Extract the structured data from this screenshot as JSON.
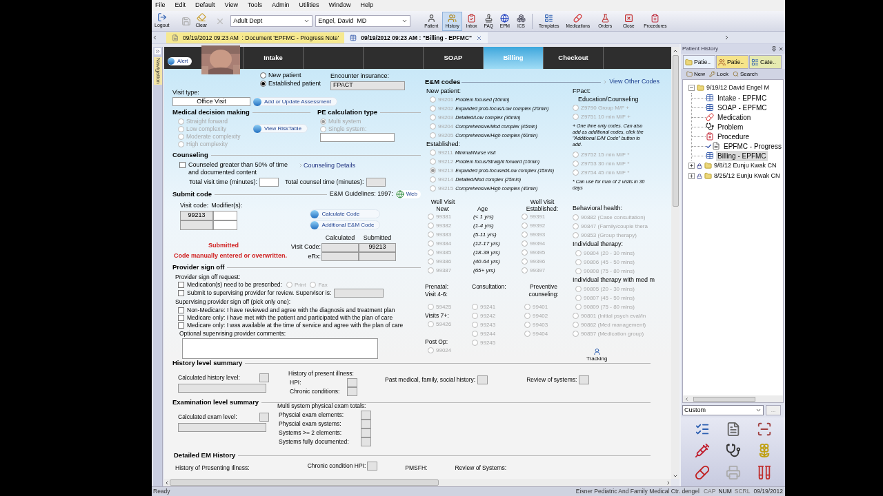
{
  "menu": [
    "File",
    "Edit",
    "Default",
    "View",
    "Tools",
    "Admin",
    "Utilities",
    "Window",
    "Help"
  ],
  "toolbar": {
    "logout": "Logout",
    "clear": "Clear",
    "department": "Adult Dept",
    "provider": "Engel, David  MD",
    "buttons": [
      {
        "label": "Patient",
        "selected": false
      },
      {
        "label": "History",
        "selected": true
      },
      {
        "label": "Inbox",
        "selected": false
      },
      {
        "label": "PAQ",
        "selected": false
      },
      {
        "label": "EPM",
        "selected": false
      },
      {
        "label": "ICS",
        "selected": false
      },
      {
        "label": "Templates",
        "selected": false
      },
      {
        "label": "Medications",
        "selected": false
      },
      {
        "label": "Orders",
        "selected": false
      },
      {
        "label": "Close",
        "selected": false
      },
      {
        "label": "Procedures",
        "selected": false
      }
    ]
  },
  "doc_tabs": [
    {
      "label": "09/19/2012 09:23 AM  : Document 'EPFMC - Progress Note'",
      "selected": false
    },
    {
      "label": "09/19/2012 09:23 AM : \"Billing - EPFMC\"",
      "selected": true
    }
  ],
  "navigation": "Navigation",
  "alert": "Alert",
  "form_tabs": [
    {
      "kind": "tab",
      "label": "Intake",
      "selected": false
    },
    {
      "kind": "blank"
    },
    {
      "kind": "blank"
    },
    {
      "kind": "tab",
      "label": "SOAP",
      "selected": false
    },
    {
      "kind": "tab",
      "label": "Billing",
      "selected": true
    },
    {
      "kind": "tab",
      "label": "Checkout",
      "selected": false
    },
    {
      "kind": "blank"
    }
  ],
  "patient_type": [
    {
      "label": "New patient",
      "selected": false
    },
    {
      "label": "Established patient",
      "selected": true
    }
  ],
  "encounter_insurance": {
    "label": "Encounter insurance:",
    "value": "FPACT"
  },
  "visit_type": {
    "label": "Visit type:",
    "value": "Office Visit"
  },
  "assessment_button": "Add or Update Assessment",
  "mdm": {
    "title": "Medical decision making",
    "disabled": true,
    "button": "View RiskTable",
    "options": [
      {
        "label": "Straight forward",
        "selected": false
      },
      {
        "label": "Low complexity",
        "selected": false
      },
      {
        "label": "Moderate complexity",
        "selected": false
      },
      {
        "label": "High complexity",
        "selected": false
      }
    ]
  },
  "pe": {
    "title": "PE calculation type",
    "disabled": true,
    "options": [
      {
        "label": "Multi system",
        "selected": true
      },
      {
        "label": "Single system:",
        "selected": false
      }
    ]
  },
  "counseling": {
    "title": "Counseling",
    "checkbox": {
      "label": "Counseled greater than 50% of time and documented content",
      "checked": false
    },
    "details_link": "Counseling Details",
    "visit_time_label": "Total visit time (minutes):",
    "counsel_time_label": "Total counsel time (minutes):"
  },
  "submit": {
    "title": "Submit code",
    "guidelines": "E&M Guidelines: 1997:",
    "web_button": "Web",
    "visit_code_label": "Visit code:",
    "modifier_label": "Modifier(s):",
    "visit_code": "99213",
    "buttons": [
      "Calculate Code",
      "Additional E&M Code"
    ],
    "status": "Submitted",
    "warning": "Code manually entered or overwritten.",
    "calculated_header": "Calculated",
    "submitted_header": "Submitted",
    "rows": [
      {
        "label": "Visit Code:",
        "submitted": "99213"
      },
      {
        "label": "eRx:"
      }
    ]
  },
  "signoff": {
    "title": "Provider sign off",
    "request_label": "Provider sign off request:",
    "medication": {
      "label": "Medication(s) need to be prescribed:",
      "checked": false
    },
    "delivery": [
      {
        "label": "Print",
        "selected": false
      },
      {
        "label": "Fax",
        "selected": false
      }
    ],
    "supervisor": {
      "label": "Submit to supervising provider for review. Supervisor is:",
      "checked": false
    },
    "supervising_label": "Supervising provider sign off (pick only one):",
    "options": [
      {
        "label": "Non-Medicare: I have reviewed and agree with the diagnosis and treatment plan",
        "checked": false
      },
      {
        "label": "Medicare only: I have met with the patient and participated with the plan of care",
        "checked": false
      },
      {
        "label": "Medicare only: I was available at the time of service and agree with the plan of care",
        "checked": false
      }
    ],
    "comments_label": "Optional supervising provider comments:"
  },
  "em": {
    "title": "E&M codes",
    "other_link": "View Other Codes",
    "new_patient": {
      "label": "New patient:",
      "codes": [
        {
          "code": "99201",
          "desc": "Problem focused (10min)",
          "selected": false
        },
        {
          "code": "99202",
          "desc": "Expanded prob-focus/Low complex (20min)",
          "selected": false
        },
        {
          "code": "99203",
          "desc": "Detailed/Low complex (30min)",
          "selected": false
        },
        {
          "code": "99204",
          "desc": "Comprehensive/Mod complex (45min)",
          "selected": false
        },
        {
          "code": "99205",
          "desc": "Comprehensive/High complex (60min)",
          "selected": false
        }
      ]
    },
    "established": {
      "label": "Established:",
      "codes": [
        {
          "code": "99211",
          "desc": "Minimal/Nurse visit",
          "selected": false
        },
        {
          "code": "99212",
          "desc": "Problem focus/Straight forward (10min)",
          "selected": false
        },
        {
          "code": "99213",
          "desc": "Expanded prob-focused/Low complex (15min)",
          "selected": true
        },
        {
          "code": "99214",
          "desc": "Detailed/Mod complex (25min)",
          "selected": false
        },
        {
          "code": "99215",
          "desc": "Comprehensive/High complex (40min)",
          "selected": false
        }
      ]
    },
    "fpact": {
      "label": "FPact:",
      "sublabel": "Education/Counseling",
      "codes": [
        {
          "code": "Z9790 Group M/F +",
          "selected": false
        },
        {
          "code": "Z9751 10 min M/F +",
          "selected": false
        }
      ],
      "note": "+ One time only codes. Can also add as additional codes, click the \"Additional E/M Code\" button to add.",
      "codes2": [
        {
          "code": "Z9752 15 min M/F *",
          "selected": false
        },
        {
          "code": "Z9753 30 min M/F *",
          "selected": false
        },
        {
          "code": "Z9754 45 min M/F *",
          "selected": false
        }
      ],
      "note2": "* Can use for max of 2 visits in 30 days"
    },
    "well_visit": {
      "new_label": "Well Visit New:",
      "age_label": "Age",
      "est_label": "Well Visit Established:",
      "rows": [
        {
          "new": {
            "code": "99381",
            "selected": false
          },
          "age": "(< 1 yrs)",
          "est": {
            "code": "99391",
            "selected": false
          }
        },
        {
          "new": {
            "code": "99382",
            "selected": false
          },
          "age": "(1-4 yrs)",
          "est": {
            "code": "99392",
            "selected": false
          }
        },
        {
          "new": {
            "code": "99383",
            "selected": false
          },
          "age": "(5-11 yrs)",
          "est": {
            "code": "99393",
            "selected": false
          }
        },
        {
          "new": {
            "code": "99384",
            "selected": false
          },
          "age": "(12-17 yrs)",
          "est": {
            "code": "99394",
            "selected": false
          }
        },
        {
          "new": {
            "code": "99385",
            "selected": false
          },
          "age": "(18-39 yrs)",
          "est": {
            "code": "99395",
            "selected": false
          }
        },
        {
          "new": {
            "code": "99386",
            "selected": false
          },
          "age": "(40-64 yrs)",
          "est": {
            "code": "99396",
            "selected": false
          }
        },
        {
          "new": {
            "code": "99387",
            "selected": false
          },
          "age": "(65+ yrs)",
          "est": {
            "code": "99397",
            "selected": false
          }
        }
      ]
    },
    "prenatal": {
      "label": "Prenatal: Visit 4-6:",
      "codes": [
        {
          "code": "59425",
          "selected": false
        }
      ],
      "label2": "Visits 7+:",
      "codes2": [
        {
          "code": "59426",
          "selected": false
        }
      ],
      "postop_label": "Post Op:",
      "postop_codes": [
        {
          "code": "99024",
          "selected": false
        }
      ]
    },
    "consultation": {
      "label": "Consultation:",
      "codes": [
        {
          "code": "99241",
          "selected": false
        },
        {
          "code": "99242",
          "selected": false
        },
        {
          "code": "99243",
          "selected": false
        },
        {
          "code": "99244",
          "selected": false
        },
        {
          "code": "99245",
          "selected": false
        }
      ]
    },
    "preventive": {
      "label": "Preventive counseling:",
      "codes": [
        {
          "code": "99401",
          "selected": false
        },
        {
          "code": "99402",
          "selected": false
        },
        {
          "code": "99403",
          "selected": false
        },
        {
          "code": "99404",
          "selected": false
        }
      ]
    },
    "behavioral": {
      "label": "Behavioral health:",
      "codes": [
        {
          "code": "90882 (Case consultation)",
          "selected": false
        },
        {
          "code": "90847 (Family/couple thera",
          "selected": false
        },
        {
          "code": "90853 (Group therapy)",
          "selected": false
        }
      ]
    },
    "individual": {
      "label": "Individual therapy:",
      "codes": [
        {
          "code": "90804 (20 - 30 mins)",
          "selected": false
        },
        {
          "code": "90806 (45 - 50 mins)",
          "selected": false
        },
        {
          "code": "90808 (75 - 80 mins)",
          "selected": false
        }
      ]
    },
    "individual_med": {
      "label": "Individual therapy with med m",
      "codes": [
        {
          "code": "90805 (20 - 30 mins)",
          "selected": false
        },
        {
          "code": "90807 (45 - 50 mins)",
          "selected": false
        },
        {
          "code": "90809 (75 - 80 mins)",
          "selected": false
        }
      ]
    },
    "other": {
      "codes": [
        {
          "code": "90801 (Initial psych eval/in",
          "selected": false
        },
        {
          "code": "90862 (Med management)",
          "selected": false
        },
        {
          "code": "90857 (Medication group)",
          "selected": false
        }
      ]
    },
    "tracking": "Tracking"
  },
  "history_summary": {
    "title": "History level summary",
    "calc_label": "Calculated history level:",
    "hpi_title": "History of present illness:",
    "hpi_fields": [
      "HPI:",
      "Chronic conditions:"
    ],
    "pmfsh": "Past medical, family, social history:",
    "ros": "Review of systems:"
  },
  "exam_summary": {
    "title": "Examination level summary",
    "calc_label": "Calculated exam level:",
    "totals_title": "Multi system physical exam totals:",
    "fields": [
      "Physcial exam elements:",
      "Physcial exam systems:",
      "Systems >= 2 elements:",
      "Systems fully documented:"
    ]
  },
  "detailed": {
    "title": "Detailed EM History",
    "presenting": "History of Presenting Illness:",
    "chronic_hpi": "Chronic condition HPI:",
    "pmsfh": "PMSFH:",
    "ros": "Review of Systems:"
  },
  "history_panel": {
    "title": "Patient History",
    "tabs": [
      {
        "label": "Patie..",
        "selected": true
      },
      {
        "label": "Patie..",
        "selected": false
      },
      {
        "label": "Cate..",
        "selected": false
      }
    ],
    "actions": [
      "New",
      "Lock",
      "Search"
    ],
    "tree": [
      {
        "label": "9/19/12 David Engel M",
        "expanded": true,
        "locked": false,
        "children": [
          {
            "label": "Intake - EPFMC",
            "kind": "form",
            "selected": false
          },
          {
            "label": "SOAP - EPFMC",
            "kind": "form",
            "selected": false
          },
          {
            "label": "Medication",
            "kind": "rx",
            "selected": false
          },
          {
            "label": "Problem",
            "kind": "dx",
            "selected": false
          },
          {
            "label": "Procedure",
            "kind": "procedure",
            "selected": false
          },
          {
            "label": "EPFMC - Progress",
            "kind": "note",
            "selected": false
          },
          {
            "label": "Billing - EPFMC",
            "kind": "form",
            "selected": true
          }
        ]
      },
      {
        "label": "9/8/12 Eunju Kwak CN",
        "expanded": false,
        "locked": true
      },
      {
        "label": "8/25/12 Eunju Kwak CN",
        "expanded": false,
        "locked": true
      }
    ],
    "view": "Custom",
    "more_button": "..."
  },
  "status": {
    "message": "Ready",
    "location": "Eisner Pediatric And Family Medical Ctr. dengel",
    "indicators": [
      {
        "label": "CAP",
        "on": false
      },
      {
        "label": "NUM",
        "on": true
      },
      {
        "label": "SCRL",
        "on": false
      }
    ],
    "date": "09/19/2012"
  }
}
